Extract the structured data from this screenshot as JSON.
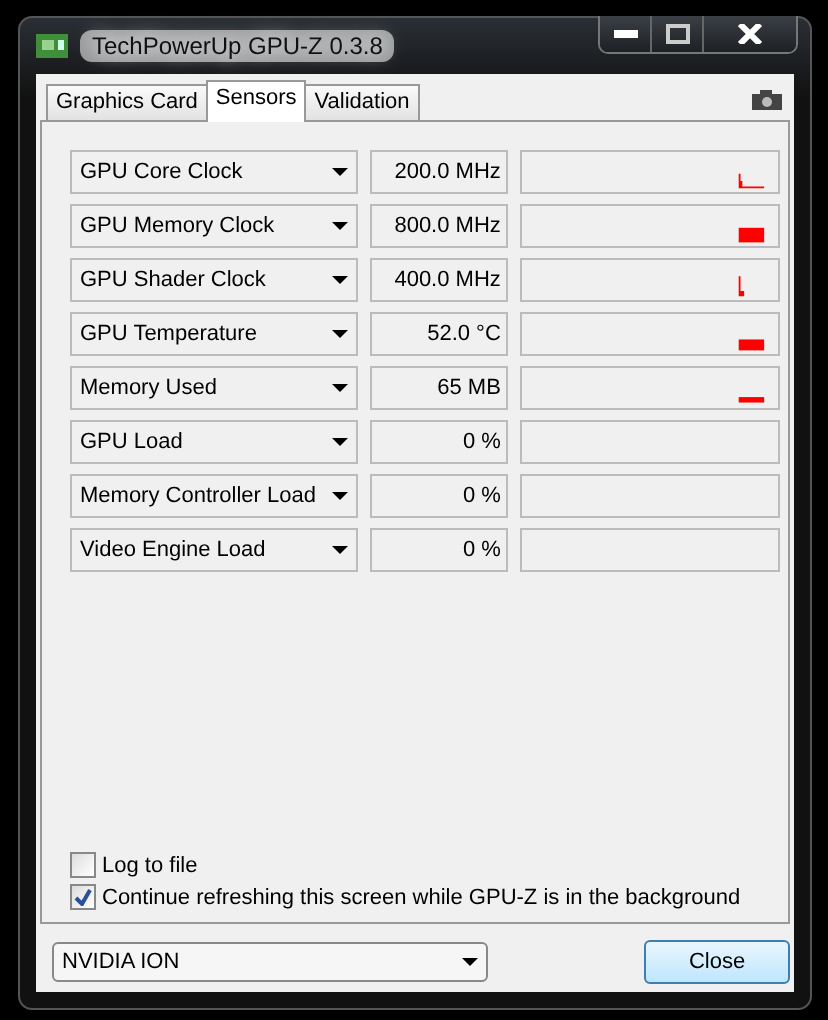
{
  "window": {
    "title": "TechPowerUp GPU-Z 0.3.8"
  },
  "tabs": [
    {
      "label": "Graphics Card",
      "selected": false
    },
    {
      "label": "Sensors",
      "selected": true
    },
    {
      "label": "Validation",
      "selected": false
    }
  ],
  "sensors": [
    {
      "name": "GPU Core Clock",
      "value": "200.0 MHz",
      "kind": "spike"
    },
    {
      "name": "GPU Memory Clock",
      "value": "800.0 MHz",
      "kind": "block"
    },
    {
      "name": "GPU Shader Clock",
      "value": "400.0 MHz",
      "kind": "needle"
    },
    {
      "name": "GPU Temperature",
      "value": "52.0 °C",
      "kind": "slab"
    },
    {
      "name": "Memory Used",
      "value": "65 MB",
      "kind": "line"
    },
    {
      "name": "GPU Load",
      "value": "0 %",
      "kind": "flat"
    },
    {
      "name": "Memory Controller Load",
      "value": "0 %",
      "kind": "flat"
    },
    {
      "name": "Video Engine Load",
      "value": "0 %",
      "kind": "flat"
    }
  ],
  "options": [
    {
      "label": "Log to file",
      "checked": false
    },
    {
      "label": "Continue refreshing this screen while GPU-Z is in the background",
      "checked": true
    }
  ],
  "device": {
    "value": "NVIDIA ION"
  },
  "buttons": [
    {
      "label": "Close"
    }
  ]
}
